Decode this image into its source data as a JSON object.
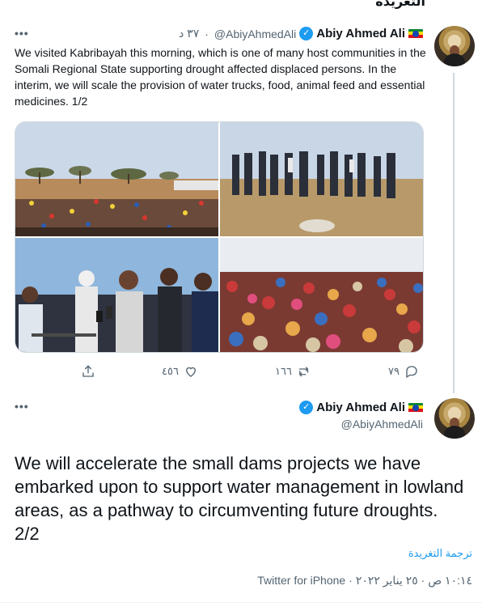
{
  "page_header_fragment": "التغريدة",
  "tweet1": {
    "author": {
      "display_name": "Abiy Ahmed Ali",
      "handle": "@AbiyAhmedAli",
      "flag": "ethiopia-flag-icon",
      "verified": true
    },
    "time_ago": "٣٧ د",
    "separator": "·",
    "more_label": "•••",
    "text": "We visited Kabribayah this morning, which is one of many host communities in the Somali Regional State supporting drought affected displaced persons. In the interim, we will scale the provision of water trucks, food, animal feed and essential medicines. 1/2",
    "photos": [
      {
        "name": "photo-crowd-plain",
        "sky": "#c9d7e6",
        "ground": "#c69b6b"
      },
      {
        "name": "photo-officials-field",
        "sky": "#d6dde8",
        "ground": "#b99468"
      },
      {
        "name": "photo-press-interview",
        "sky": "#8fb4d8",
        "ground": "#3b3f4a"
      },
      {
        "name": "photo-crowd-women",
        "sky": "#e6e9ef",
        "ground": "#9b3b3b"
      }
    ],
    "actions": {
      "share": "",
      "likes": "٤٥٦",
      "retweets": "١٦٦",
      "replies": "٧٩"
    }
  },
  "tweet2": {
    "author": {
      "display_name": "Abiy Ahmed Ali",
      "handle": "@AbiyAhmedAli",
      "flag": "ethiopia-flag-icon",
      "verified": true
    },
    "more_label": "•••",
    "text": "We will accelerate the small dams projects we have embarked upon to support water management in lowland areas, as a pathway to circumventing future droughts. 2/2",
    "translate_label": "ترجمة التغريدة",
    "timestamp": "١٠:١٤ ص · ٢٥ يناير ٢٠٢٢",
    "separator": "·",
    "source": "Twitter for iPhone"
  },
  "colors": {
    "accent": "#1d9bf0",
    "text_primary": "#0f1419",
    "text_secondary": "#536471",
    "border": "#cfd9de"
  }
}
